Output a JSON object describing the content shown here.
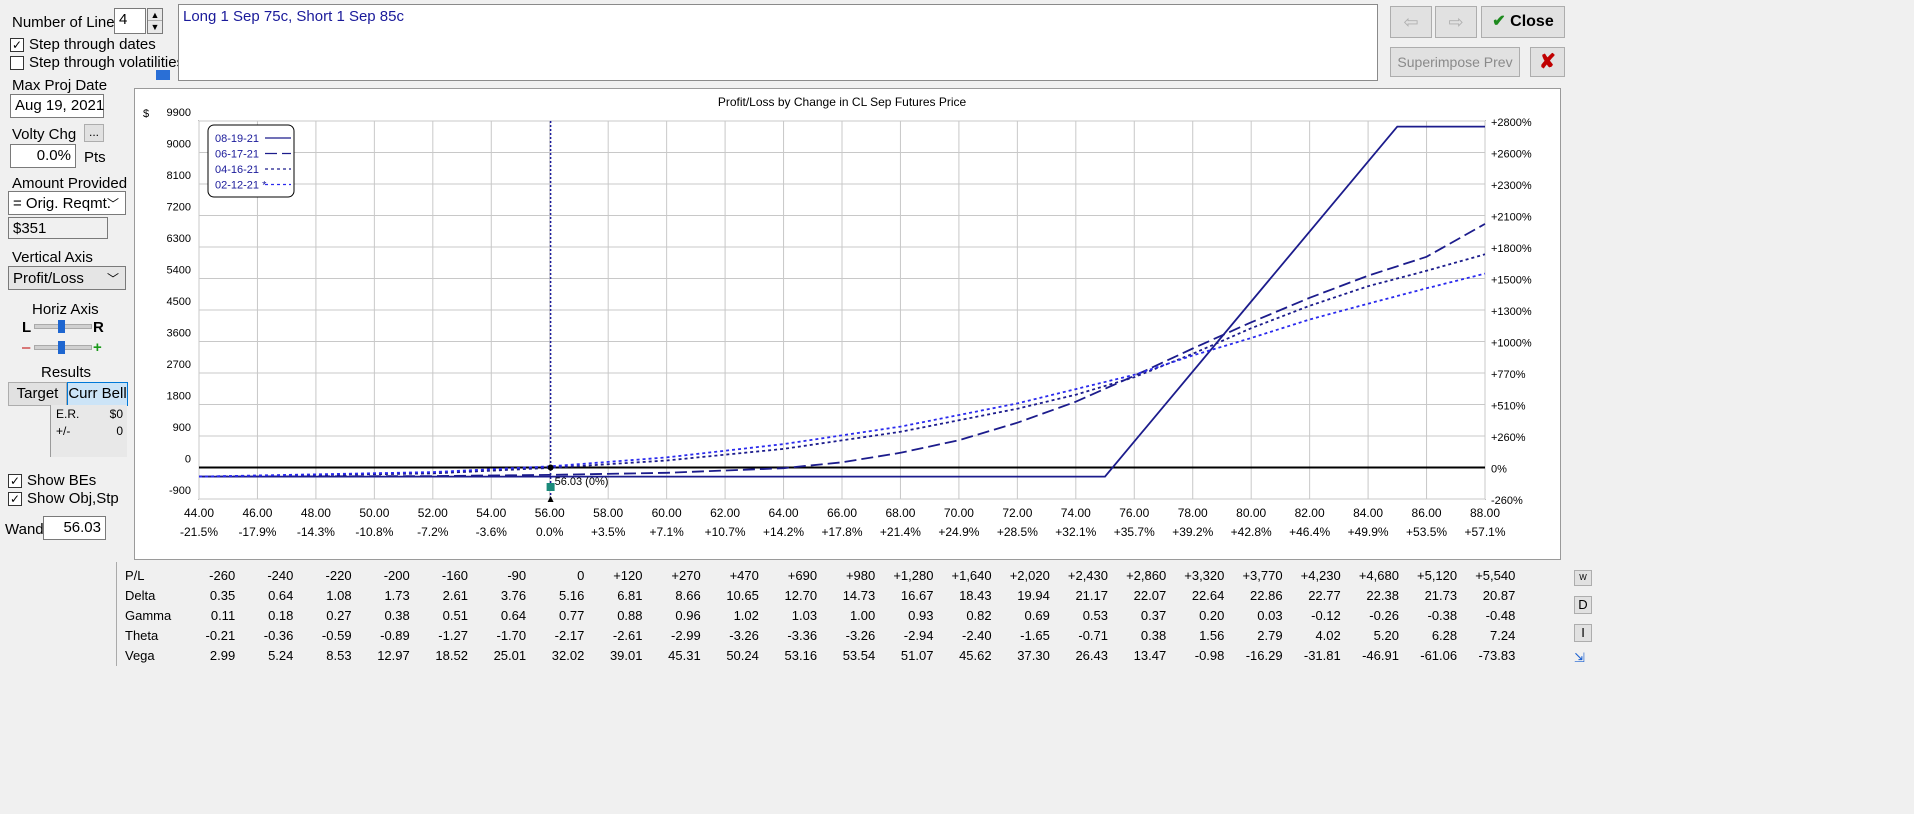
{
  "left": {
    "num_lines_label": "Number of Lines",
    "num_lines_value": "4",
    "step_dates_label": "Step through dates",
    "step_dates_checked": true,
    "step_vol_label": "Step through volatilities",
    "step_vol_checked": false,
    "max_proj_label": "Max Proj Date",
    "max_proj_value": "Aug 19, 2021",
    "volty_label": "Volty Chg",
    "volty_btn": "...",
    "volty_value": "0.0%",
    "volty_unit": "Pts",
    "amount_label": "Amount Provided",
    "amount_select": "= Orig. Reqmt.",
    "amount_value": "$351",
    "vaxis_label": "Vertical Axis",
    "vaxis_select": "Profit/Loss",
    "haxis_label": "Horiz Axis",
    "l_label": "L",
    "r_label": "R",
    "minus_label": "–",
    "plus_label": "+",
    "results_label": "Results",
    "target_tab": "Target",
    "currbell_tab": "Curr Bell",
    "er_label": "E.R.",
    "er_value": "$0",
    "pm_label": "+/-",
    "pm_value": "0",
    "show_bes_label": "Show BEs",
    "show_obj_label": "Show Obj,Stp",
    "wand_label": "Wand",
    "wand_value": "56.03"
  },
  "top": {
    "position_text": "Long 1 Sep 75c, Short 1 Sep 85c",
    "close_label": "Close",
    "superimpose_label": "Superimpose Prev"
  },
  "chart_data": {
    "type": "line",
    "title": "Profit/Loss by Change in CL Sep Futures Price",
    "ylabel": "$",
    "x_ticks": [
      "44.00",
      "46.00",
      "48.00",
      "50.00",
      "52.00",
      "54.00",
      "56.00",
      "58.00",
      "60.00",
      "62.00",
      "64.00",
      "66.00",
      "68.00",
      "70.00",
      "72.00",
      "74.00",
      "76.00",
      "78.00",
      "80.00",
      "82.00",
      "84.00",
      "86.00",
      "88.00"
    ],
    "x_pct_ticks": [
      "-21.5%",
      "-17.9%",
      "-14.3%",
      "-10.8%",
      "-7.2%",
      "-3.6%",
      "0.0%",
      "+3.5%",
      "+7.1%",
      "+10.7%",
      "+14.2%",
      "+17.8%",
      "+21.4%",
      "+24.9%",
      "+28.5%",
      "+32.1%",
      "+35.7%",
      "+39.2%",
      "+42.8%",
      "+46.4%",
      "+49.9%",
      "+53.5%",
      "+57.1%"
    ],
    "y_ticks": [
      "9900",
      "9000",
      "8100",
      "7200",
      "6300",
      "5400",
      "4500",
      "3600",
      "2700",
      "1800",
      "900",
      "0",
      "-900"
    ],
    "y_pct_ticks": [
      "+2800%",
      "+2600%",
      "+2300%",
      "+2100%",
      "+1800%",
      "+1500%",
      "+1300%",
      "+1000%",
      "+770%",
      "+510%",
      "+260%",
      "0%",
      "-260%"
    ],
    "xlim": [
      44,
      88
    ],
    "ylim": [
      -900,
      9900
    ],
    "wand_x": 56.03,
    "wand_label": "56.03 (0%)",
    "legend": [
      "08-19-21",
      "06-17-21",
      "04-16-21",
      "02-12-21 *"
    ],
    "series": [
      {
        "name": "08-19-21",
        "color": "#1c1c8c",
        "dash": "",
        "points": [
          [
            44,
            -260
          ],
          [
            75,
            -260
          ],
          [
            85,
            9740
          ],
          [
            88,
            9740
          ]
        ]
      },
      {
        "name": "06-17-21",
        "color": "#1c1c8c",
        "dash": "12,5",
        "points": [
          [
            44,
            -260
          ],
          [
            52,
            -245
          ],
          [
            56,
            -210
          ],
          [
            60,
            -150
          ],
          [
            64,
            -20
          ],
          [
            66,
            150
          ],
          [
            68,
            420
          ],
          [
            70,
            780
          ],
          [
            72,
            1280
          ],
          [
            74,
            1880
          ],
          [
            76,
            2620
          ],
          [
            78,
            3400
          ],
          [
            80,
            4150
          ],
          [
            82,
            4850
          ],
          [
            84,
            5480
          ],
          [
            86,
            6020
          ],
          [
            88,
            6960
          ]
        ]
      },
      {
        "name": "04-16-21",
        "color": "#1c1c8c",
        "dash": "3,3",
        "points": [
          [
            44,
            -260
          ],
          [
            52,
            -170
          ],
          [
            56,
            -10
          ],
          [
            60,
            200
          ],
          [
            64,
            530
          ],
          [
            68,
            1020
          ],
          [
            72,
            1680
          ],
          [
            74,
            2080
          ],
          [
            76,
            2580
          ],
          [
            78,
            3250
          ],
          [
            80,
            3980
          ],
          [
            82,
            4620
          ],
          [
            84,
            5180
          ],
          [
            86,
            5620
          ],
          [
            88,
            6090
          ]
        ]
      },
      {
        "name": "02-12-21 *",
        "color": "#2a2aee",
        "dash": "3,3",
        "points": [
          [
            44,
            -260
          ],
          [
            52,
            -130
          ],
          [
            56,
            30
          ],
          [
            60,
            290
          ],
          [
            64,
            670
          ],
          [
            68,
            1170
          ],
          [
            72,
            1830
          ],
          [
            76,
            2650
          ],
          [
            78,
            3200
          ],
          [
            80,
            3700
          ],
          [
            82,
            4230
          ],
          [
            84,
            4680
          ],
          [
            86,
            5120
          ],
          [
            88,
            5540
          ]
        ]
      }
    ]
  },
  "greeks": {
    "rows": [
      {
        "label": "P/L",
        "values": [
          "-260",
          "-240",
          "-220",
          "-200",
          "-160",
          "-90",
          "0",
          "+120",
          "+270",
          "+470",
          "+690",
          "+980",
          "+1,280",
          "+1,640",
          "+2,020",
          "+2,430",
          "+2,860",
          "+3,320",
          "+3,770",
          "+4,230",
          "+4,680",
          "+5,120",
          "+5,540"
        ]
      },
      {
        "label": "Delta",
        "values": [
          "0.35",
          "0.64",
          "1.08",
          "1.73",
          "2.61",
          "3.76",
          "5.16",
          "6.81",
          "8.66",
          "10.65",
          "12.70",
          "14.73",
          "16.67",
          "18.43",
          "19.94",
          "21.17",
          "22.07",
          "22.64",
          "22.86",
          "22.77",
          "22.38",
          "21.73",
          "20.87"
        ]
      },
      {
        "label": "Gamma",
        "values": [
          "0.11",
          "0.18",
          "0.27",
          "0.38",
          "0.51",
          "0.64",
          "0.77",
          "0.88",
          "0.96",
          "1.02",
          "1.03",
          "1.00",
          "0.93",
          "0.82",
          "0.69",
          "0.53",
          "0.37",
          "0.20",
          "0.03",
          "-0.12",
          "-0.26",
          "-0.38",
          "-0.48"
        ]
      },
      {
        "label": "Theta",
        "values": [
          "-0.21",
          "-0.36",
          "-0.59",
          "-0.89",
          "-1.27",
          "-1.70",
          "-2.17",
          "-2.61",
          "-2.99",
          "-3.26",
          "-3.36",
          "-3.26",
          "-2.94",
          "-2.40",
          "-1.65",
          "-0.71",
          "0.38",
          "1.56",
          "2.79",
          "4.02",
          "5.20",
          "6.28",
          "7.24"
        ]
      },
      {
        "label": "Vega",
        "values": [
          "2.99",
          "5.24",
          "8.53",
          "12.97",
          "18.52",
          "25.01",
          "32.02",
          "39.01",
          "45.31",
          "50.24",
          "53.16",
          "53.54",
          "51.07",
          "45.62",
          "37.30",
          "26.43",
          "13.47",
          "-0.98",
          "-16.29",
          "-31.81",
          "-46.91",
          "-61.06",
          "-73.83"
        ]
      }
    ],
    "side_buttons": [
      "W",
      "D",
      "I"
    ]
  }
}
